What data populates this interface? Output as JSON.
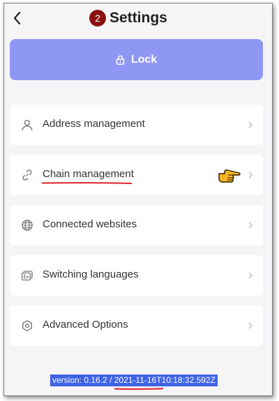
{
  "header": {
    "back_icon": "chevron-left-icon",
    "step_badge": "2",
    "title": "Settings"
  },
  "lock_button": {
    "icon": "lock-icon",
    "label": "Lock",
    "color": "#8f97f4"
  },
  "menu": {
    "items": [
      {
        "icon": "user-icon",
        "label": "Address management"
      },
      {
        "icon": "link-icon",
        "label": "Chain management"
      },
      {
        "icon": "globe-icon",
        "label": "Connected websites"
      },
      {
        "icon": "language-icon",
        "label": "Switching languages"
      },
      {
        "icon": "settings-icon",
        "label": "Advanced Options"
      }
    ]
  },
  "annotations": {
    "underline_color": "#e0202a",
    "pointer_icon": "pointing-hand-icon"
  },
  "footer": {
    "version_text": "version: 0.16.2 / 2021-11-16T10:18:32.592Z",
    "selection_color": "#3f63e6"
  }
}
